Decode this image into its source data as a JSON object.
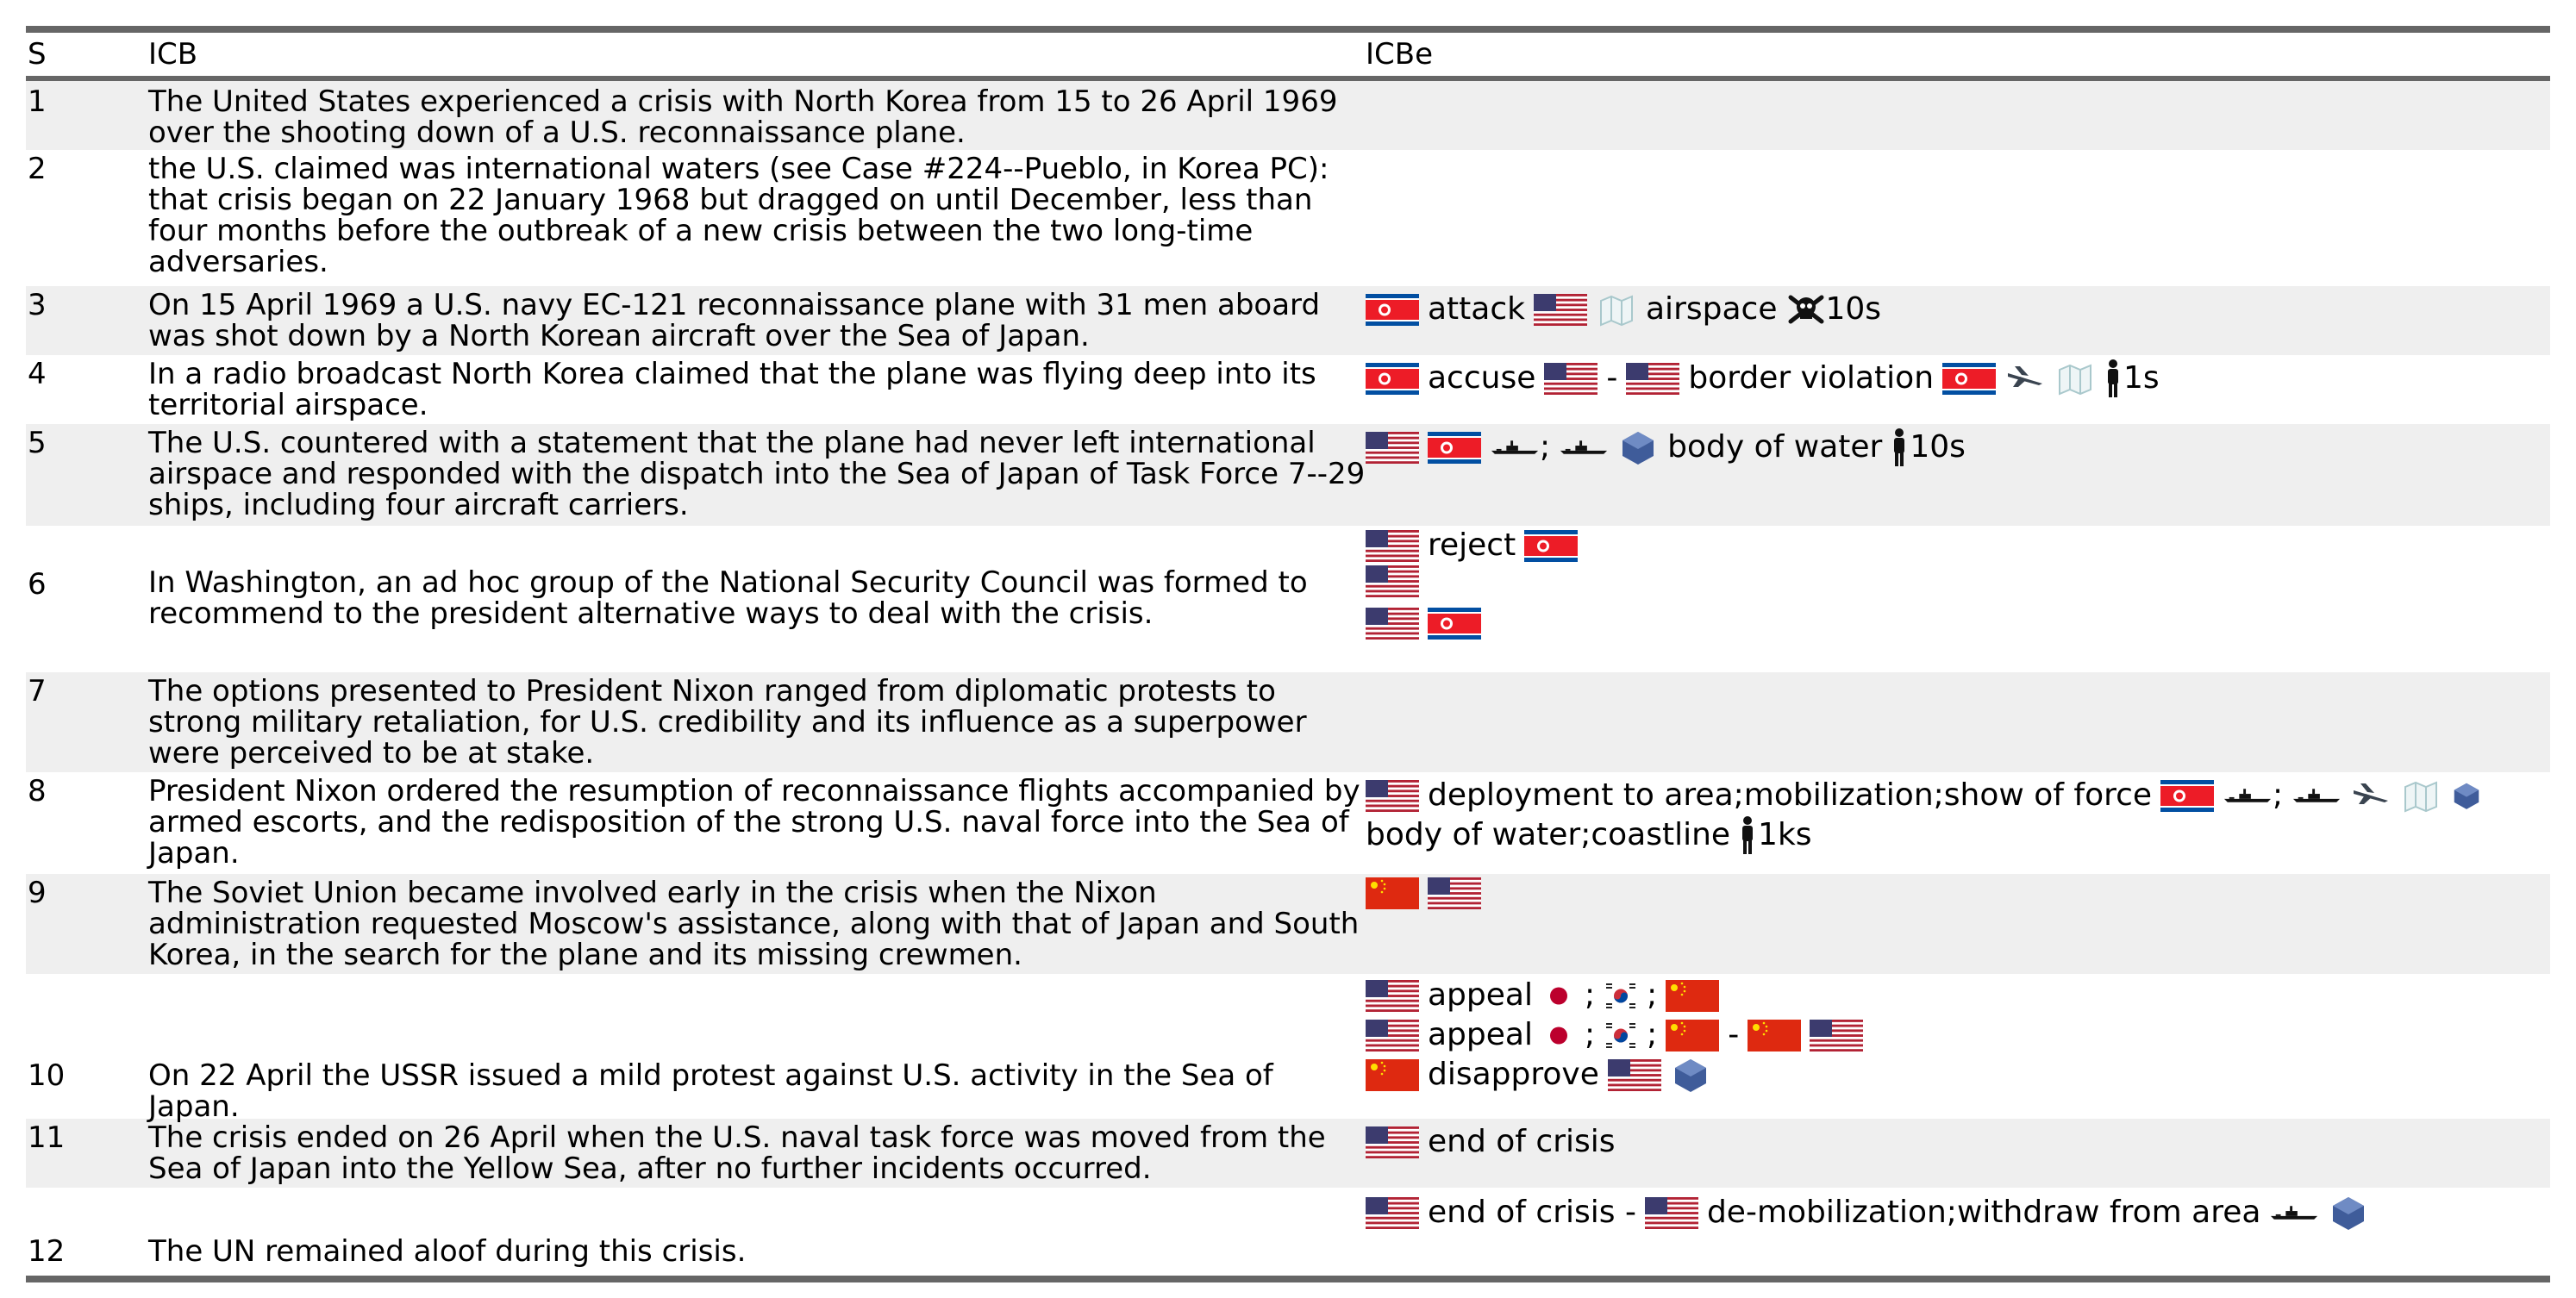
{
  "headers": {
    "s": "S",
    "icb": "ICB",
    "icbe": "ICBe"
  },
  "rows": [
    {
      "s": "1",
      "icb": "The United States experienced a crisis with North Korea from 15 to 26 April 1969 over the shooting down of a U.S. reconnaissance plane."
    },
    {
      "s": "2",
      "icb": "the U.S. claimed was international waters (see Case #224--Pueblo, in Korea PC): that crisis began on 22 January 1968 but dragged on until December, less than four months before the outbreak of a new crisis between the two long-time adversaries."
    },
    {
      "s": "3",
      "icb": "On 15 April 1969 a U.S. navy EC-121 reconnaissance plane with 31 men aboard was shot down by a North Korean aircraft over the Sea of Japan.",
      "ev_attack": "attack",
      "ev_airspace": "airspace",
      "ev_deaths": "10s"
    },
    {
      "s": "4",
      "icb": "In a radio broadcast North Korea claimed that the plane was flying deep into its territorial airspace.",
      "ev_accuse": "accuse",
      "ev_dash": "-",
      "ev_border": "border violation",
      "ev_count": "1s"
    },
    {
      "s": "5",
      "icb": "The U.S. countered with a statement that the plane had never left international airspace and responded with the dispatch into the Sea of Japan of Task Force 7--29 ships, including four aircraft carriers.",
      "ev_sep": ";",
      "ev_water": "body of water",
      "ev_count": "10s"
    },
    {
      "s": "6",
      "icb": "In Washington, an ad hoc group of the National Security Council was formed to recommend to the president alternative ways to deal with the crisis.",
      "ev_reject": "reject"
    },
    {
      "s": "7",
      "icb": "The options presented to President Nixon ranged from diplomatic protests to strong military retaliation, for U.S. credibility and its influence as a superpower were perceived to be at stake."
    },
    {
      "s": "8",
      "icb": "President Nixon ordered the resumption of reconnaissance flights accompanied by armed escorts, and the redisposition of the strong U.S. naval force into the Sea of Japan.",
      "ev_deploy": "deployment to area;mobilization;show of force",
      "ev_sep": ";",
      "ev_loc": "body of water;coastline",
      "ev_count": "1ks"
    },
    {
      "s": "9",
      "icb": "The Soviet Union became involved early in the crisis when the Nixon administration requested Moscow's assistance, along with that of Japan and South Korea, in the search for the plane and its missing crewmen.",
      "ev_appeal": "appeal",
      "ev_sep": ";",
      "ev_dash": "-"
    },
    {
      "s": "10",
      "icb": "On 22 April the USSR issued a mild protest against U.S. activity in the Sea of Japan.",
      "ev_disapprove": "disapprove"
    },
    {
      "s": "11",
      "icb": "The crisis ended on 26 April when the U.S. naval task force was moved from the Sea of Japan into the Yellow Sea, after no further incidents occurred.",
      "ev_end": "end of crisis"
    },
    {
      "s": "12",
      "icb": "The UN remained aloof during this crisis.",
      "ev_end_dash": "end of crisis -",
      "ev_demob": "de-mobilization;withdraw from area"
    }
  ],
  "flags": {
    "usa": "usa-flag",
    "north_korea": "north-korea-flag",
    "china": "china-flag",
    "japan": "japan-flag",
    "south_korea": "south-korea-flag"
  },
  "colors": {
    "rule": "#666666",
    "shade": "#efefef",
    "usa_red": "#b22234",
    "usa_blue": "#3c3b6e",
    "nk_red": "#ed1c27",
    "nk_blue": "#024fa2",
    "china_red": "#de2910",
    "china_yellow": "#ffde00",
    "japan_red": "#bc002d"
  },
  "icons": [
    "map-icon",
    "skull-crossbones-icon",
    "jet-icon",
    "warship-icon",
    "water-icon",
    "person-icon"
  ]
}
